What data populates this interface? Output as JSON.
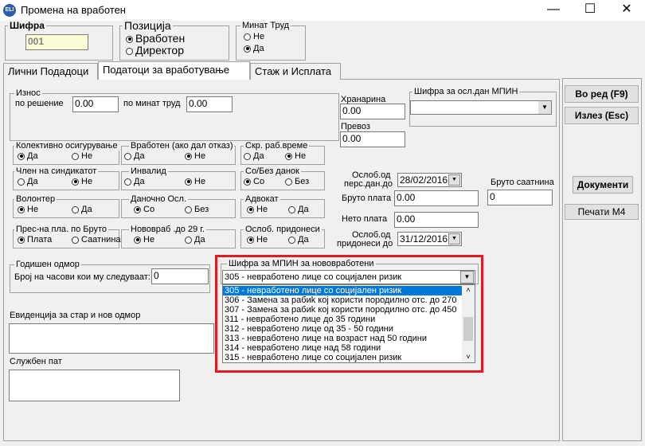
{
  "window": {
    "title": "Промена на вработен",
    "icon_text": "ELI",
    "minimize": "—",
    "maximize": "☐",
    "close": "✕"
  },
  "header": {
    "sifra_label": "Шифра",
    "sifra_value": "001",
    "pozicija_label": "Позиција",
    "pozicija_options": [
      "Вработен",
      "Директор"
    ],
    "minat_trud_label": "Минат Труд",
    "minat_trud_options": [
      "Не",
      "Да"
    ]
  },
  "tabs": [
    "Лични Подадоци",
    "Податоци за вработување",
    "Стаж и Исплата"
  ],
  "iznos": {
    "label": "Износ",
    "po_resenie_label": "по решение",
    "po_resenie_value": "0.00",
    "po_minat_trud_label": "по минат труд",
    "po_minat_trud_value": "0.00"
  },
  "hranarina": {
    "label": "Хранарина",
    "value": "0.00"
  },
  "prevoz": {
    "label": "Превоз",
    "value": "0.00"
  },
  "sifra_mpin": {
    "label": "Шифра за осл.дан МПИН",
    "value": ""
  },
  "radio_groups": [
    {
      "label": "Колективно осигурување",
      "options": [
        "Да",
        "Не"
      ],
      "selected": 0
    },
    {
      "label": "Вработен (ако дал отказ)",
      "options": [
        "Да",
        "Не"
      ],
      "selected": 1
    },
    {
      "label": "Скр. раб.време",
      "options": [
        "Да",
        "Не"
      ],
      "selected": 1
    },
    {
      "label": "Член на синдикатот",
      "options": [
        "Да",
        "Не"
      ],
      "selected": 1
    },
    {
      "label": "Инвалид",
      "options": [
        "Да",
        "Не"
      ],
      "selected": 1
    },
    {
      "label": "Со/Без данок",
      "options": [
        "Со",
        "Без"
      ],
      "selected": 0
    },
    {
      "label": "Волонтер",
      "options": [
        "Не",
        "Да"
      ],
      "selected": 0
    },
    {
      "label": "Даночно Осл.",
      "options": [
        "Со",
        "Без"
      ],
      "selected": 0
    },
    {
      "label": "Адвокат",
      "options": [
        "Не",
        "Да"
      ],
      "selected": 0
    },
    {
      "label": "Прес-на пла. по  Бруто",
      "options": [
        "Плата",
        "Саатнина"
      ],
      "selected": 0
    },
    {
      "label": "Нововраб .до 29 г.",
      "options": [
        "Не",
        "Да"
      ],
      "selected": 0
    },
    {
      "label": "Ослоб. придонеси",
      "options": [
        "Не",
        "Да"
      ],
      "selected": 0
    }
  ],
  "oslob_pers": {
    "label1": "Ослоб.од",
    "label2": "перс.дан.до",
    "value": "28/02/2016"
  },
  "bruto_saatnina": {
    "label": "Бруто саатнина",
    "value": "0"
  },
  "bruto_plata": {
    "label": "Бруто плата",
    "value": "0.00"
  },
  "neto_plata": {
    "label": "Нето плата",
    "value": "0.00"
  },
  "oslob_pridonesi": {
    "label1": "Ослоб.од",
    "label2": "придонеси до",
    "value": "31/12/2016"
  },
  "godishen_odmor": {
    "label": "Годишен одмор",
    "chasovi_label": "Број на часови кои му следуваат:",
    "chasovi_value": "0"
  },
  "evidencija": {
    "label": "Евиденција за стар и нов одмор"
  },
  "sluzben_pat": {
    "label": "Службен пат"
  },
  "mpin_novovraboteni": {
    "label": "Шифра за МПИН за нововработени",
    "selected": "305 - невработено лице со социјален ризик",
    "options": [
      "305 - невработено лице со социјален ризик",
      "306 - Замена за рабиk кој користи породилно отс. до 270",
      "307 - Замена за рабиk кој користи породилно отс. до 450",
      "311 - невработено лице до 35 години",
      "312 - невработено лице од 35 - 50 години",
      "313 - невработено лице на возраст над 50 години",
      "314 - невработено лице над 58 години",
      "315 - невработено лице со социјален ризик"
    ]
  },
  "buttons": {
    "vo_red": "Во ред (F9)",
    "izlez": "Излез (Esc)",
    "dokumenti": "Документи",
    "pechati": "Печати М4"
  },
  "colors": {
    "highlight_border": "#e01b24",
    "selection": "#0078d7"
  }
}
